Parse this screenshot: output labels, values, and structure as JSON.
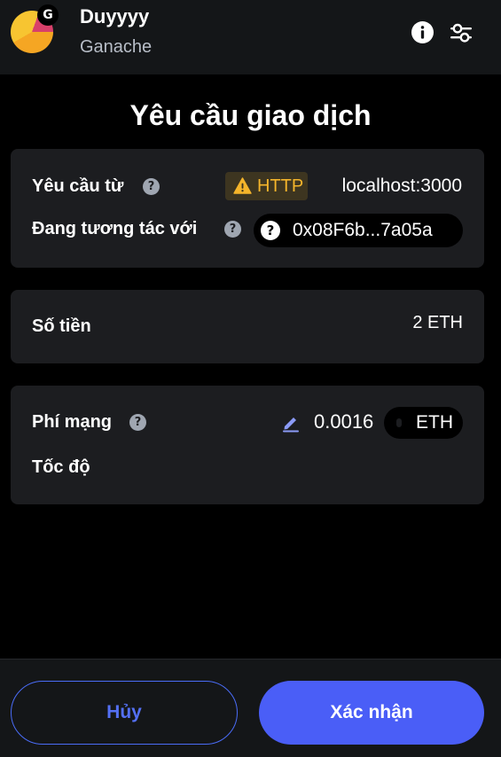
{
  "header": {
    "account_name": "Duyyyy",
    "network_name": "Ganache",
    "network_badge": "G"
  },
  "title": "Yêu cầu giao dịch",
  "request": {
    "from_label": "Yêu cầu từ",
    "protocol": "HTTP",
    "origin": "localhost:3000",
    "interacting_label": "Đang tương tác với",
    "contract_address": "0x08F6b...7a05a"
  },
  "amount": {
    "label": "Số tiền",
    "value": "2 ETH"
  },
  "fee": {
    "label": "Phí mạng",
    "value": "0.0016",
    "currency": "ETH",
    "speed_label": "Tốc độ"
  },
  "footer": {
    "cancel_label": "Hủy",
    "confirm_label": "Xác nhận"
  },
  "help_glyph": "?",
  "colors": {
    "accent": "#4a5ef7",
    "warning": "#f5b52b",
    "card_bg": "#1c1d20"
  },
  "icons": {
    "info": "info-icon",
    "settings": "sliders-icon",
    "warning": "warning-icon",
    "edit": "pencil-icon"
  }
}
